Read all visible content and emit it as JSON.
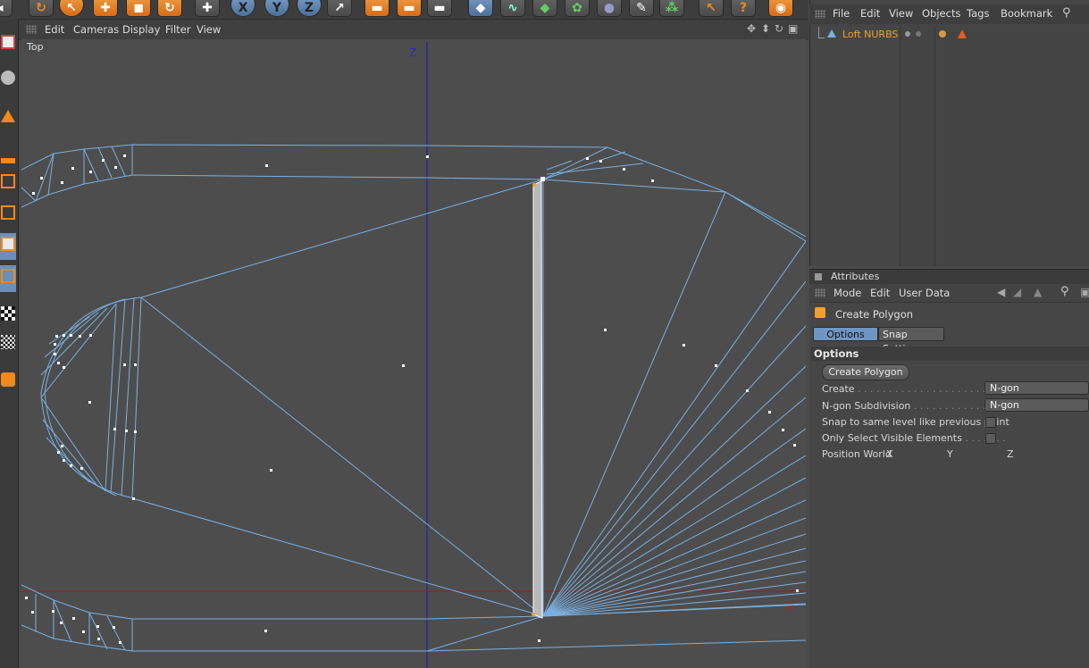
{
  "colors": {
    "viewport_bg": "#4d4d4d",
    "wire": "#7ab0e2",
    "z_axis": "#2222aa",
    "x_axis": "#a01c1c",
    "accent_orange": "#f08a1a",
    "selection_blue": "#6f95c2"
  },
  "toolbar": {
    "icons": [
      "undo-icon",
      "live-select-icon",
      "move-icon",
      "scale-icon",
      "rotate-icon",
      "add-icon",
      "x-axis-lock-icon",
      "y-axis-lock-icon",
      "z-axis-lock-icon",
      "world-coordinates-icon",
      "render-view-icon",
      "render-picture-viewer-icon",
      "edit-render-settings-icon",
      "cube-icon",
      "pen-spline-icon",
      "subdivision-surface-icon",
      "array-icon",
      "deformer-icon",
      "scene-icon",
      "camera-icon",
      "light-icon",
      "help-icon"
    ]
  },
  "viewport": {
    "menu": [
      "Edit",
      "Cameras",
      "Display",
      "Filter",
      "View"
    ],
    "view_name": "Top",
    "axis_z_label": "Z",
    "axis_x_label": "X"
  },
  "object_manager": {
    "menu": [
      "File",
      "Edit",
      "View",
      "Objects",
      "Tags",
      "Bookmark"
    ],
    "objects": [
      {
        "name": "Loft NURBS"
      }
    ]
  },
  "attributes": {
    "title": "Attributes",
    "menu": [
      "Mode",
      "Edit",
      "User Data"
    ],
    "tool_name": "Create Polygon",
    "tabs": [
      {
        "label": "Options",
        "active": true
      },
      {
        "label": "Snap Settings",
        "active": false
      }
    ],
    "section": "Options",
    "button": "Create Polygon",
    "fields": {
      "create_label": "Create",
      "create_value": "N-gon",
      "ngon_sub_label": "N-gon Subdivision",
      "ngon_sub_value": "N-gon",
      "snap_label": "Snap to same level like previous point",
      "snap_checked": false,
      "visible_label": "Only Select Visible Elements",
      "visible_checked": false,
      "position_label": "Position World",
      "pos_x": "X",
      "pos_y": "Y",
      "pos_z": "Z"
    }
  }
}
